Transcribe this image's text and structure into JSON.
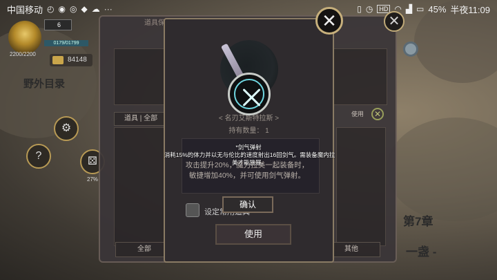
{
  "statusbar": {
    "carrier": "中国移动",
    "battery": "45%",
    "time": "半夜11:09",
    "hd_badge": "HD"
  },
  "hud": {
    "hp": "2200/2200",
    "level": "6",
    "xp": "0179/01799",
    "gold": "84148"
  },
  "map": {
    "field_label": "野外目录",
    "completion": "27%",
    "chapter": "第7章",
    "chapter_sub": "一盏 -"
  },
  "inventory": {
    "title": "道具保",
    "tab": "道具 | 全部",
    "auto_use_label": "使用",
    "buttons": [
      "全部",
      "其他"
    ]
  },
  "item_detail": {
    "name": "< 名刃艾斯特拉斯 >",
    "quantity_label": "持有数量：",
    "quantity": "1",
    "description": "攻击提升20%，魔力拉美一起装备时，敏捷增加40%，并可使用剑气弹射。",
    "checkbox_label": "设定常用道具",
    "use_button": "使用"
  },
  "skill_tooltip": {
    "title": "*剑气弹射",
    "description": "消耗15%的体力并以无与伦比的速度射出16回剑气。需装备魔内拉美才能施展。",
    "confirm_button": "确认"
  }
}
